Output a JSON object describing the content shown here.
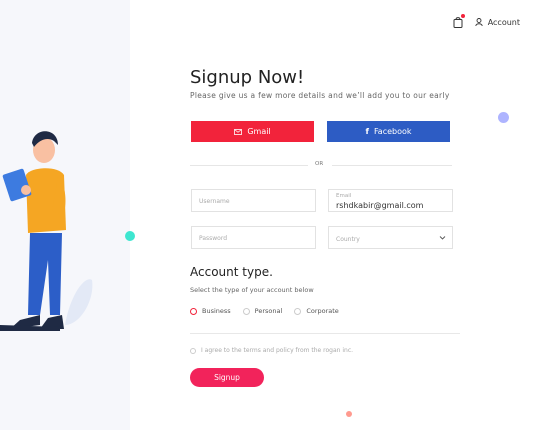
{
  "header": {
    "account_label": "Account"
  },
  "form": {
    "title": "Signup Now!",
    "subtitle": "Please give us a few more details and we’ll add you to  our early",
    "gmail_label": "Gmail",
    "facebook_label": "Facebook",
    "or_label": "OR",
    "username_placeholder": "Username",
    "email_label": "Email",
    "email_value": "rshdkabir@gmail.com",
    "password_placeholder": "Password",
    "country_placeholder": "Country"
  },
  "account_type": {
    "title": "Account type.",
    "subtitle": "Select the type of your account below",
    "options": [
      "Business",
      "Personal",
      "Corporate"
    ],
    "selected": "Business"
  },
  "terms_label": "I agree to the terms and policy from the rogan inc.",
  "signup_label": "Signup",
  "colors": {
    "accent": "#f2233b",
    "facebook": "#2d5cc4",
    "signup": "#f2235b"
  }
}
